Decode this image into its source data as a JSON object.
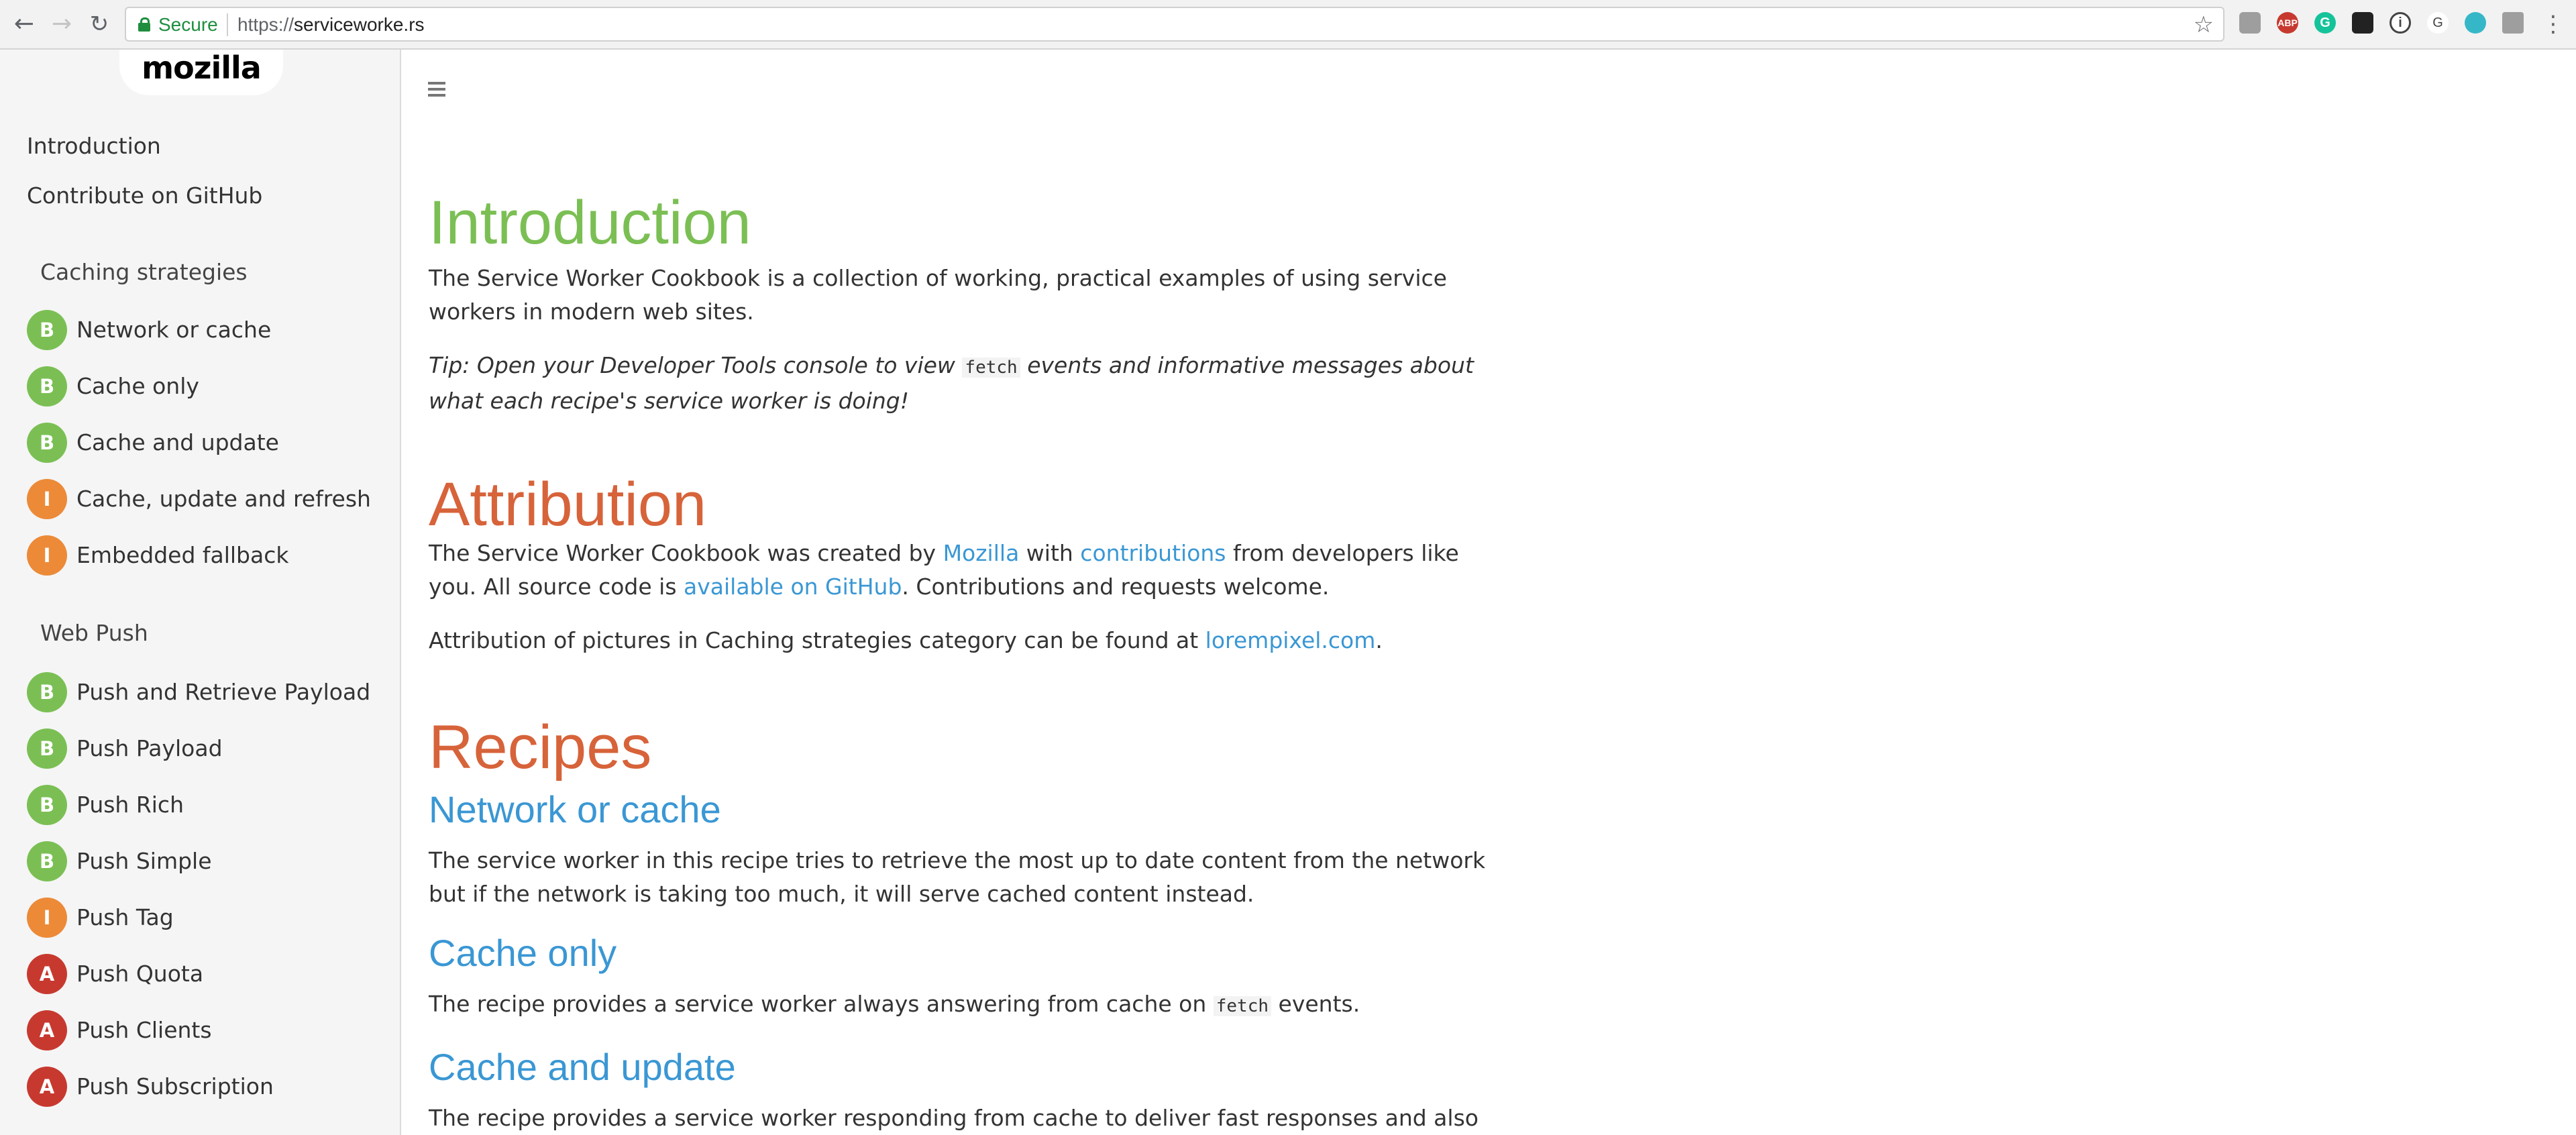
{
  "browser": {
    "back_icon": "arrow-left-icon",
    "forward_icon": "arrow-right-icon",
    "reload_icon": "reload-icon",
    "secure_label": "Secure",
    "url_scheme": "https://",
    "url_host": "serviceworke.rs",
    "bookmark_icon": "star-icon",
    "menu_icon": "kebab-menu-icon"
  },
  "sidebar": {
    "logo": "mozilla",
    "links": [
      {
        "label": "Introduction"
      },
      {
        "label": "Contribute on GitHub"
      }
    ],
    "sections": [
      {
        "title": "Caching strategies",
        "items": [
          {
            "badge": "B",
            "label": "Network or cache"
          },
          {
            "badge": "B",
            "label": "Cache only"
          },
          {
            "badge": "B",
            "label": "Cache and update"
          },
          {
            "badge": "I",
            "label": "Cache, update and refresh"
          },
          {
            "badge": "I",
            "label": "Embedded fallback"
          }
        ]
      },
      {
        "title": "Web Push",
        "items": [
          {
            "badge": "B",
            "label": "Push and Retrieve Payload"
          },
          {
            "badge": "B",
            "label": "Push Payload"
          },
          {
            "badge": "B",
            "label": "Push Rich"
          },
          {
            "badge": "B",
            "label": "Push Simple"
          },
          {
            "badge": "I",
            "label": "Push Tag"
          },
          {
            "badge": "A",
            "label": "Push Quota"
          },
          {
            "badge": "A",
            "label": "Push Clients"
          },
          {
            "badge": "A",
            "label": "Push Subscription"
          }
        ]
      }
    ],
    "badge_colors": {
      "B": "#7bbf54",
      "I": "#ec8a38",
      "A": "#c7392f"
    }
  },
  "main": {
    "menu_icon": "hamburger-icon",
    "intro": {
      "heading": "Introduction",
      "heading_color": "#7bbf54",
      "p1": "The Service Worker Cookbook is a collection of working, practical examples of using service workers in modern web sites.",
      "tip_prefix": "Tip: Open your Developer Tools console to view ",
      "tip_code": "fetch",
      "tip_suffix": " events and informative messages about what each recipe's service worker is doing!"
    },
    "attribution": {
      "heading": "Attribution",
      "heading_color": "#d7633a",
      "p1_a": "The Service Worker Cookbook was created by ",
      "link_mozilla": "Mozilla",
      "p1_b": " with ",
      "link_contributions": "contributions",
      "p1_c": " from developers like you. All source code is ",
      "link_github": "available on GitHub",
      "p1_d": ". Contributions and requests welcome.",
      "p2_a": "Attribution of pictures in Caching strategies category can be found at ",
      "link_lorem": "lorempixel.com",
      "p2_b": "."
    },
    "recipes": {
      "heading": "Recipes",
      "heading_color": "#d7633a",
      "network_or_cache": {
        "title": "Network or cache",
        "desc": "The service worker in this recipe tries to retrieve the most up to date content from the network but if the network is taking too much, it will serve cached content instead."
      },
      "cache_only": {
        "title": "Cache only",
        "desc_a": "The recipe provides a service worker always answering from cache on ",
        "desc_code": "fetch",
        "desc_b": " events."
      },
      "cache_and_update": {
        "title": "Cache and update",
        "desc": "The recipe provides a service worker responding from cache to deliver fast responses and also updating"
      }
    }
  }
}
